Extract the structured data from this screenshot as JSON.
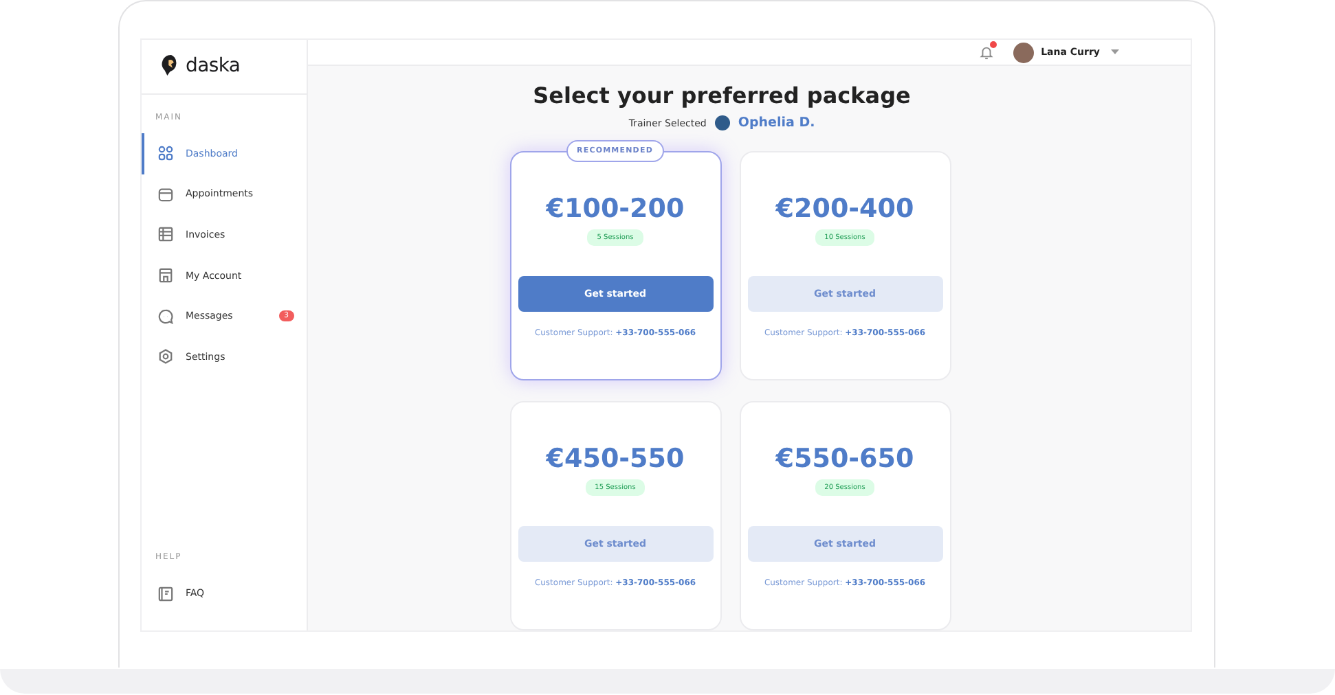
{
  "brand": {
    "name": "daska"
  },
  "header": {
    "notification_dot": true,
    "user_name": "Lana Curry"
  },
  "sidebar": {
    "sections": [
      {
        "title": "MAIN",
        "items": [
          {
            "label": "Dashboard",
            "selected": true
          },
          {
            "label": "Appointments",
            "selected": false
          },
          {
            "label": "Invoices",
            "selected": false
          },
          {
            "label": "My Account",
            "selected": false
          },
          {
            "label": "Messages",
            "selected": false,
            "badge": "3"
          },
          {
            "label": "Settings",
            "selected": false
          }
        ]
      },
      {
        "title": "HELP",
        "items": [
          {
            "label": "FAQ",
            "selected": false
          }
        ]
      }
    ]
  },
  "page": {
    "title": "Select your preferred package",
    "trainer_label": "Trainer Selected",
    "trainer_name": "Ophelia D."
  },
  "packages": [
    {
      "price": "€100-200",
      "sessions": "5 Sessions",
      "button": "Get started",
      "support_label": "Customer Support:",
      "support_phone": "+33-700-555-066",
      "highlighted": true,
      "badge": "RECOMMENDED"
    },
    {
      "price": "€200-400",
      "sessions": "10 Sessions",
      "button": "Get started",
      "support_label": "Customer Support:",
      "support_phone": "+33-700-555-066",
      "highlighted": false
    },
    {
      "price": "€450-550",
      "sessions": "15 Sessions",
      "button": "Get started",
      "support_label": "Customer Support:",
      "support_phone": "+33-700-555-066",
      "highlighted": false
    },
    {
      "price": "€550-650",
      "sessions": "20 Sessions",
      "button": "Get started",
      "support_label": "Customer Support:",
      "support_phone": "+33-700-555-066",
      "highlighted": false
    }
  ]
}
